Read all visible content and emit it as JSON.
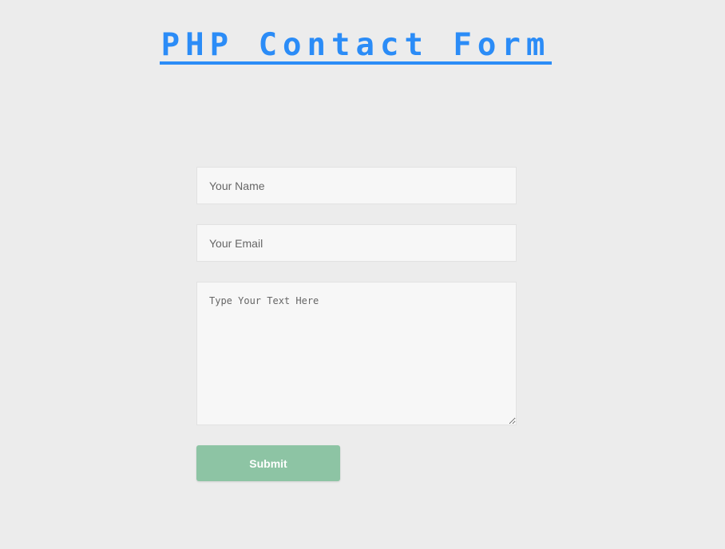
{
  "page": {
    "title": "PHP Contact Form"
  },
  "form": {
    "name_placeholder": "Your Name",
    "email_placeholder": "Your Email",
    "message_placeholder": "Type Your Text Here",
    "submit_label": "Submit"
  },
  "colors": {
    "background": "#ececec",
    "title": "#2b8cf7",
    "submit_button": "#8dc4a4",
    "field_background": "#f7f7f7"
  }
}
